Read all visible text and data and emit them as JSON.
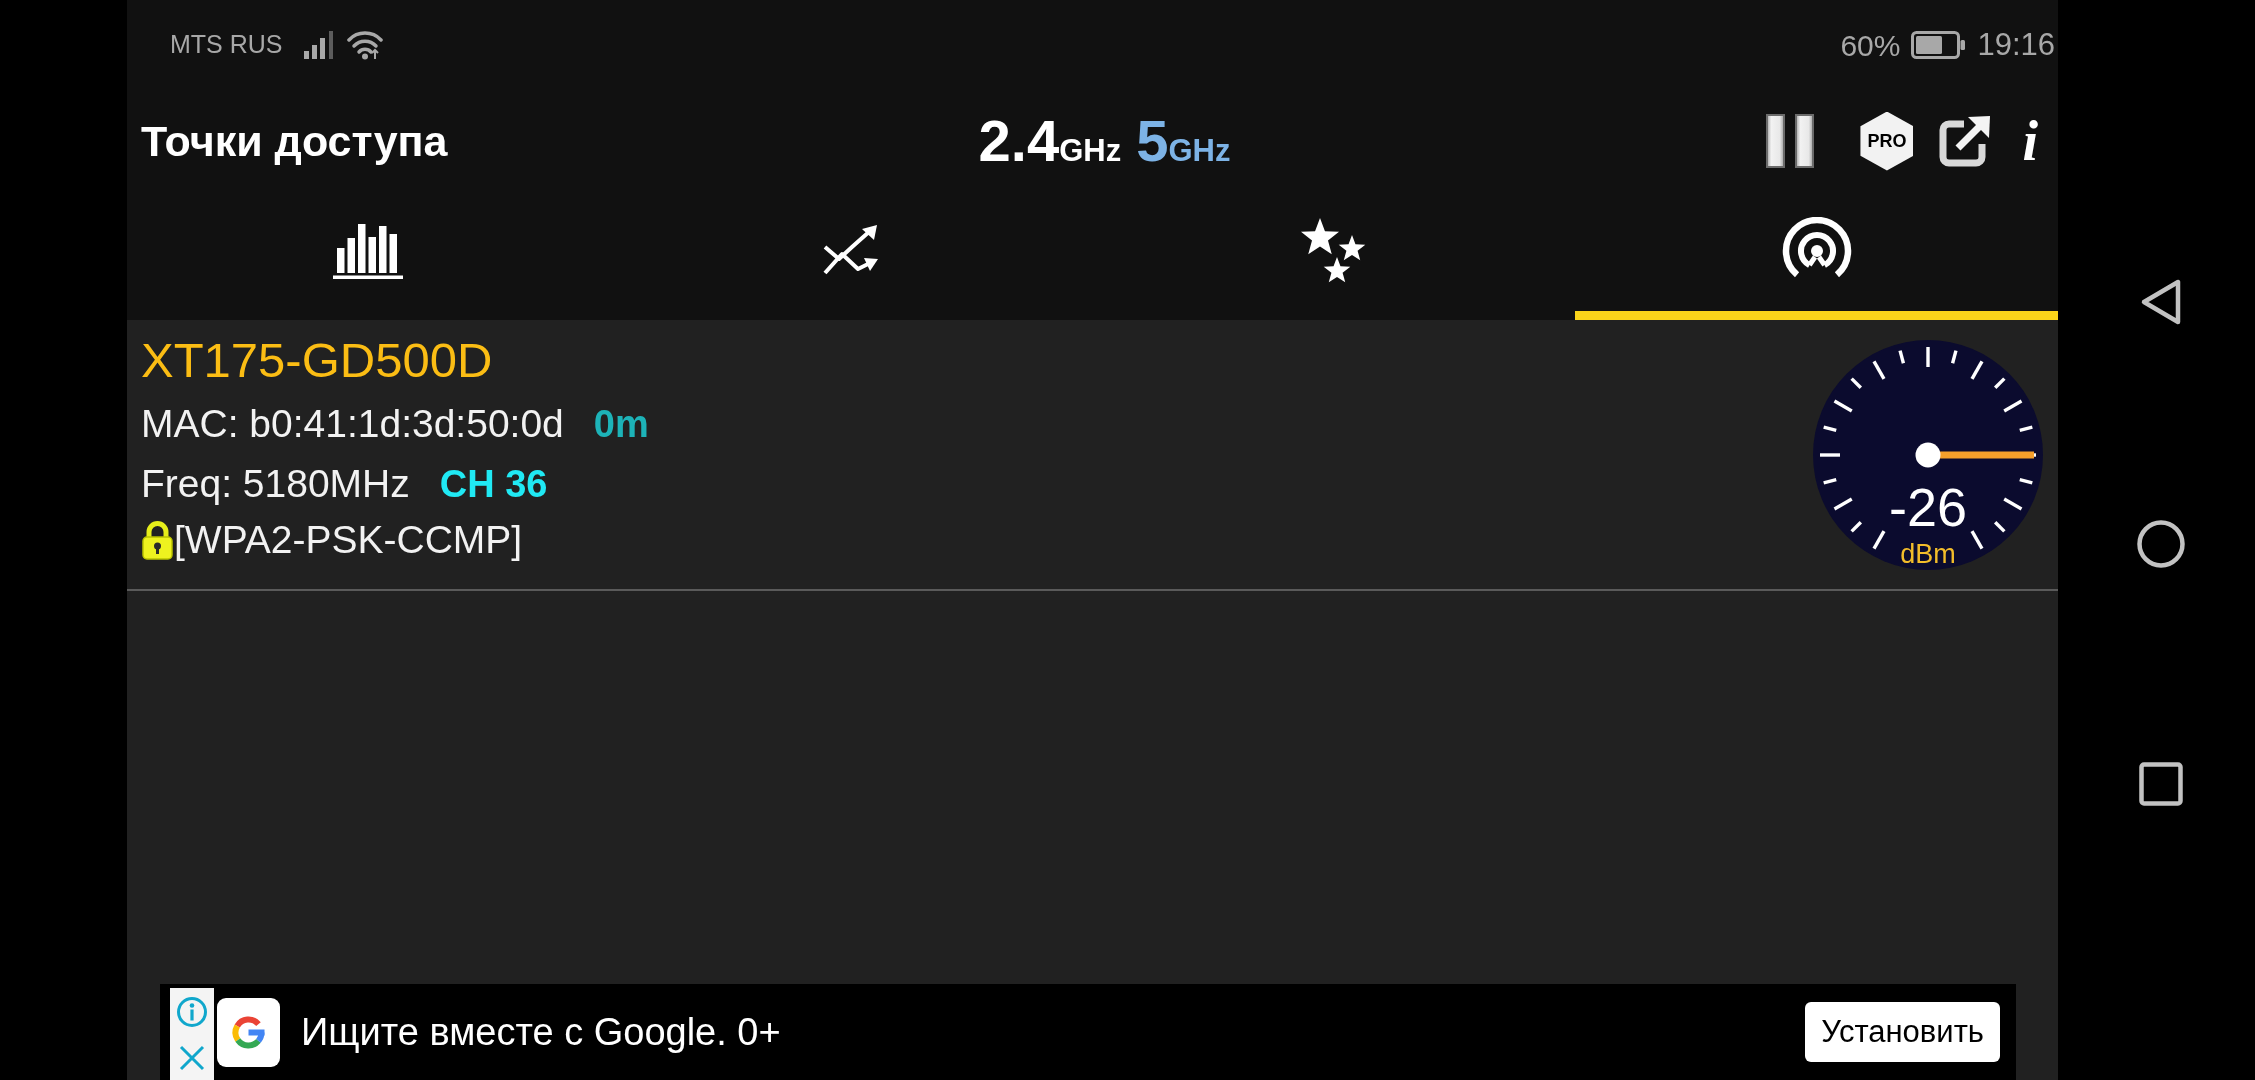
{
  "status_bar": {
    "carrier": "MTS RUS",
    "battery": "60%",
    "time": "19:16"
  },
  "header": {
    "title": "Точки доступа",
    "bands": [
      {
        "value": "2.4",
        "unit": "GHz",
        "selected": false
      },
      {
        "value": "5",
        "unit": "GHz",
        "selected": true
      }
    ],
    "pro_badge": "PRO",
    "info": "i"
  },
  "tabs": [
    {
      "selected": false
    },
    {
      "selected": false
    },
    {
      "selected": false
    },
    {
      "selected": true
    }
  ],
  "networks": [
    {
      "name": "XT175-GD500D",
      "color": "#fbbd14",
      "mac": "MAC: b0:41:1d:3d:50:0d",
      "distance": "0m",
      "frequency": "Freq: 5180MHz",
      "channel": "CH 36",
      "security": "[WPA2-PSK-CCMP]",
      "signal": {
        "reading": "-26",
        "unit": "dBm"
      }
    }
  ],
  "ad": {
    "text": "Ищите вместе с Google. 0+",
    "button": "Установить"
  }
}
